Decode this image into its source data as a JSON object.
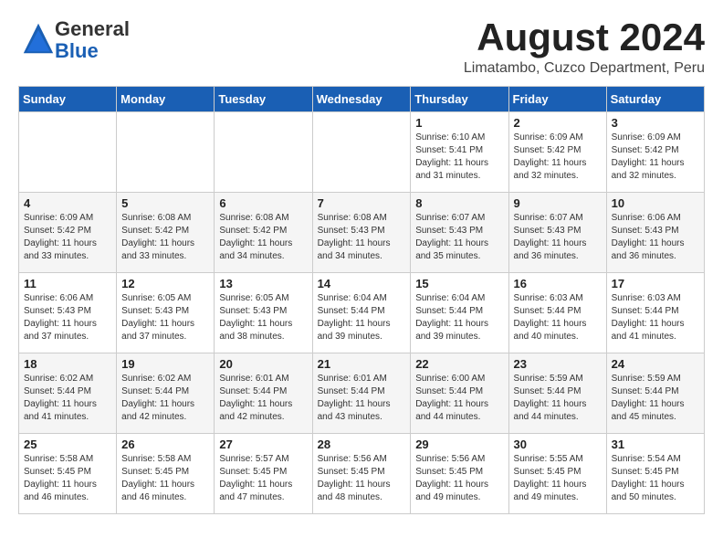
{
  "header": {
    "logo_general": "General",
    "logo_blue": "Blue",
    "month_year": "August 2024",
    "location": "Limatambo, Cuzco Department, Peru"
  },
  "days_of_week": [
    "Sunday",
    "Monday",
    "Tuesday",
    "Wednesday",
    "Thursday",
    "Friday",
    "Saturday"
  ],
  "weeks": [
    [
      {
        "day": "",
        "info": ""
      },
      {
        "day": "",
        "info": ""
      },
      {
        "day": "",
        "info": ""
      },
      {
        "day": "",
        "info": ""
      },
      {
        "day": "1",
        "info": "Sunrise: 6:10 AM\nSunset: 5:41 PM\nDaylight: 11 hours and 31 minutes."
      },
      {
        "day": "2",
        "info": "Sunrise: 6:09 AM\nSunset: 5:42 PM\nDaylight: 11 hours and 32 minutes."
      },
      {
        "day": "3",
        "info": "Sunrise: 6:09 AM\nSunset: 5:42 PM\nDaylight: 11 hours and 32 minutes."
      }
    ],
    [
      {
        "day": "4",
        "info": "Sunrise: 6:09 AM\nSunset: 5:42 PM\nDaylight: 11 hours and 33 minutes."
      },
      {
        "day": "5",
        "info": "Sunrise: 6:08 AM\nSunset: 5:42 PM\nDaylight: 11 hours and 33 minutes."
      },
      {
        "day": "6",
        "info": "Sunrise: 6:08 AM\nSunset: 5:42 PM\nDaylight: 11 hours and 34 minutes."
      },
      {
        "day": "7",
        "info": "Sunrise: 6:08 AM\nSunset: 5:43 PM\nDaylight: 11 hours and 34 minutes."
      },
      {
        "day": "8",
        "info": "Sunrise: 6:07 AM\nSunset: 5:43 PM\nDaylight: 11 hours and 35 minutes."
      },
      {
        "day": "9",
        "info": "Sunrise: 6:07 AM\nSunset: 5:43 PM\nDaylight: 11 hours and 36 minutes."
      },
      {
        "day": "10",
        "info": "Sunrise: 6:06 AM\nSunset: 5:43 PM\nDaylight: 11 hours and 36 minutes."
      }
    ],
    [
      {
        "day": "11",
        "info": "Sunrise: 6:06 AM\nSunset: 5:43 PM\nDaylight: 11 hours and 37 minutes."
      },
      {
        "day": "12",
        "info": "Sunrise: 6:05 AM\nSunset: 5:43 PM\nDaylight: 11 hours and 37 minutes."
      },
      {
        "day": "13",
        "info": "Sunrise: 6:05 AM\nSunset: 5:43 PM\nDaylight: 11 hours and 38 minutes."
      },
      {
        "day": "14",
        "info": "Sunrise: 6:04 AM\nSunset: 5:44 PM\nDaylight: 11 hours and 39 minutes."
      },
      {
        "day": "15",
        "info": "Sunrise: 6:04 AM\nSunset: 5:44 PM\nDaylight: 11 hours and 39 minutes."
      },
      {
        "day": "16",
        "info": "Sunrise: 6:03 AM\nSunset: 5:44 PM\nDaylight: 11 hours and 40 minutes."
      },
      {
        "day": "17",
        "info": "Sunrise: 6:03 AM\nSunset: 5:44 PM\nDaylight: 11 hours and 41 minutes."
      }
    ],
    [
      {
        "day": "18",
        "info": "Sunrise: 6:02 AM\nSunset: 5:44 PM\nDaylight: 11 hours and 41 minutes."
      },
      {
        "day": "19",
        "info": "Sunrise: 6:02 AM\nSunset: 5:44 PM\nDaylight: 11 hours and 42 minutes."
      },
      {
        "day": "20",
        "info": "Sunrise: 6:01 AM\nSunset: 5:44 PM\nDaylight: 11 hours and 42 minutes."
      },
      {
        "day": "21",
        "info": "Sunrise: 6:01 AM\nSunset: 5:44 PM\nDaylight: 11 hours and 43 minutes."
      },
      {
        "day": "22",
        "info": "Sunrise: 6:00 AM\nSunset: 5:44 PM\nDaylight: 11 hours and 44 minutes."
      },
      {
        "day": "23",
        "info": "Sunrise: 5:59 AM\nSunset: 5:44 PM\nDaylight: 11 hours and 44 minutes."
      },
      {
        "day": "24",
        "info": "Sunrise: 5:59 AM\nSunset: 5:44 PM\nDaylight: 11 hours and 45 minutes."
      }
    ],
    [
      {
        "day": "25",
        "info": "Sunrise: 5:58 AM\nSunset: 5:45 PM\nDaylight: 11 hours and 46 minutes."
      },
      {
        "day": "26",
        "info": "Sunrise: 5:58 AM\nSunset: 5:45 PM\nDaylight: 11 hours and 46 minutes."
      },
      {
        "day": "27",
        "info": "Sunrise: 5:57 AM\nSunset: 5:45 PM\nDaylight: 11 hours and 47 minutes."
      },
      {
        "day": "28",
        "info": "Sunrise: 5:56 AM\nSunset: 5:45 PM\nDaylight: 11 hours and 48 minutes."
      },
      {
        "day": "29",
        "info": "Sunrise: 5:56 AM\nSunset: 5:45 PM\nDaylight: 11 hours and 49 minutes."
      },
      {
        "day": "30",
        "info": "Sunrise: 5:55 AM\nSunset: 5:45 PM\nDaylight: 11 hours and 49 minutes."
      },
      {
        "day": "31",
        "info": "Sunrise: 5:54 AM\nSunset: 5:45 PM\nDaylight: 11 hours and 50 minutes."
      }
    ]
  ]
}
